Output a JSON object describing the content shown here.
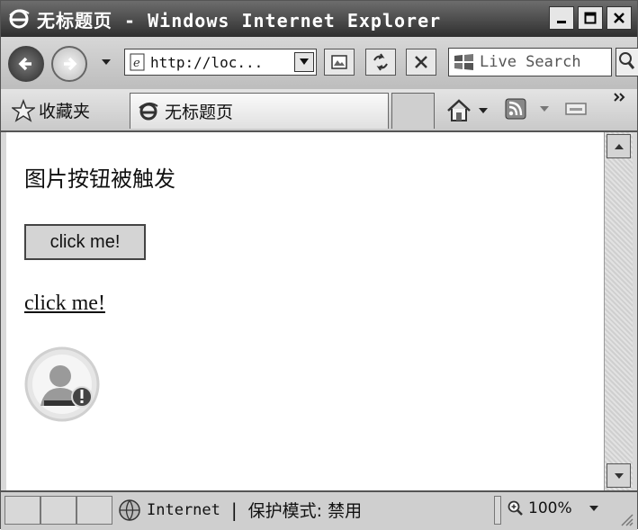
{
  "window": {
    "title": "无标题页 - Windows Internet Explorer"
  },
  "address": {
    "url": "http://loc...",
    "search_placeholder": "Live Search"
  },
  "favorites": {
    "label": "收藏夹",
    "tab_title": "无标题页"
  },
  "page": {
    "heading": "图片按钮被触发",
    "button_label": "click me!",
    "link_text": "click me!"
  },
  "status": {
    "zone": "Internet",
    "separator": "|",
    "mode": "保护模式: 禁用",
    "zoom": "100%"
  },
  "icons": {
    "title": "ie-logo-icon",
    "back": "back-arrow-icon",
    "forward": "forward-arrow-icon",
    "page": "page-icon",
    "refresh": "refresh-icon",
    "stop": "stop-icon",
    "search": "search-icon",
    "star": "star-icon",
    "home": "home-icon",
    "feed": "rss-feed-icon",
    "print": "print-icon",
    "globe": "globe-icon",
    "zoom": "magnifier-icon",
    "avatar": "user-avatar-icon"
  }
}
